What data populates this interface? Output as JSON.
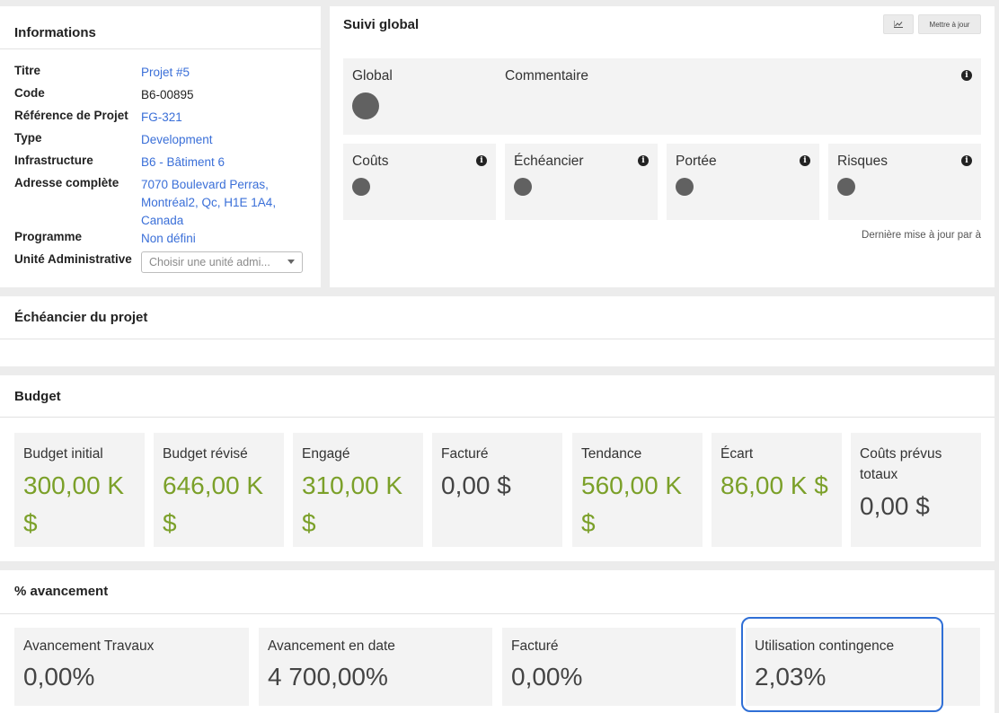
{
  "informations": {
    "title": "Informations",
    "rows": [
      {
        "label": "Titre",
        "value": "Projet #5"
      },
      {
        "label": "Code",
        "value": "B6-00895"
      },
      {
        "label": "Référence de Projet",
        "value": "FG-321"
      },
      {
        "label": "Type",
        "value": "Development"
      },
      {
        "label": "Infrastructure",
        "value": "B6 - Bâtiment 6"
      },
      {
        "label": "Adresse complète",
        "value_lines": [
          "7070 Boulevard Perras,",
          "Montréal2, Qc, H1E 1A4,",
          "Canada"
        ]
      },
      {
        "label": "Programme",
        "value": "Non défini"
      },
      {
        "label": "Unité Administrative",
        "placeholder": "Choisir une unité admi..."
      }
    ]
  },
  "suivi_global": {
    "title": "Suivi global",
    "chart_button_icon": "line-chart-icon",
    "update_button": "Mettre à jour",
    "global_label": "Global",
    "comment_label": "Commentaire",
    "indicators": [
      {
        "label": "Coûts"
      },
      {
        "label": "Échéancier"
      },
      {
        "label": "Portée"
      },
      {
        "label": "Risques"
      }
    ],
    "last_update": "Dernière mise à jour par à",
    "status_color": "#616161"
  },
  "echeancier": {
    "title": "Échéancier du projet"
  },
  "budget": {
    "title": "Budget",
    "cards": [
      {
        "label": "Budget initial",
        "value_lines": [
          "300,00 K",
          "$"
        ],
        "color": "#7ba029"
      },
      {
        "label": "Budget révisé",
        "value_lines": [
          "646,00 K",
          "$"
        ],
        "color": "#7ba029"
      },
      {
        "label": "Engagé",
        "value_lines": [
          "310,00 K",
          "$"
        ],
        "color": "#7ba029"
      },
      {
        "label": "Facturé",
        "value_lines": [
          "0,00 $"
        ],
        "color": "#444444"
      },
      {
        "label": "Tendance",
        "value_lines": [
          "560,00 K",
          "$"
        ],
        "color": "#7ba029"
      },
      {
        "label": "Écart",
        "value_lines": [
          "86,00 K $"
        ],
        "color": "#7ba029"
      },
      {
        "label_lines": [
          "Coûts prévus",
          "totaux"
        ],
        "value_lines": [
          "0,00 $"
        ],
        "color": "#444444"
      }
    ]
  },
  "avancement": {
    "title": "% avancement",
    "cards": [
      {
        "label": "Avancement Travaux",
        "value": "0,00%"
      },
      {
        "label": "Avancement en date",
        "value": "4 700,00%"
      },
      {
        "label": "Facturé",
        "value": "0,00%"
      },
      {
        "label": "Utilisation contingence",
        "value": "2,03%"
      }
    ],
    "highlight_color": "#2f6fd6"
  }
}
